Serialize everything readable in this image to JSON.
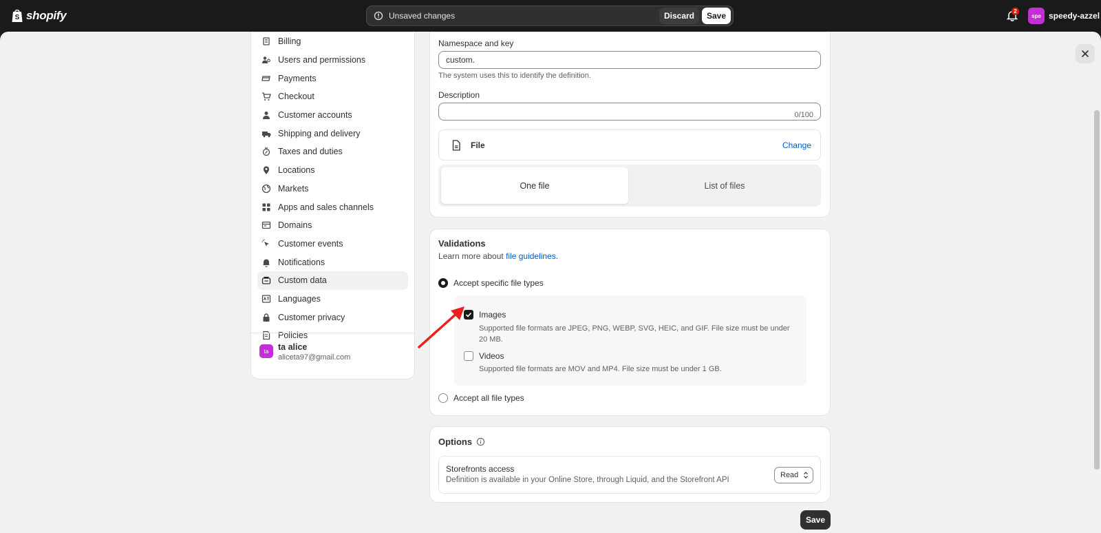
{
  "topbar": {
    "logo_text": "shopify",
    "unsaved_message": "Unsaved changes",
    "discard_label": "Discard",
    "save_label": "Save",
    "notification_count": "2",
    "store_avatar": "spe",
    "store_name": "speedy-azzel"
  },
  "sidebar": {
    "items": [
      {
        "label": "Billing",
        "icon": "billing-icon"
      },
      {
        "label": "Users and permissions",
        "icon": "users-icon"
      },
      {
        "label": "Payments",
        "icon": "payments-icon"
      },
      {
        "label": "Checkout",
        "icon": "cart-icon"
      },
      {
        "label": "Customer accounts",
        "icon": "person-icon"
      },
      {
        "label": "Shipping and delivery",
        "icon": "truck-icon"
      },
      {
        "label": "Taxes and duties",
        "icon": "taxes-icon"
      },
      {
        "label": "Locations",
        "icon": "location-icon"
      },
      {
        "label": "Markets",
        "icon": "globe-icon"
      },
      {
        "label": "Apps and sales channels",
        "icon": "apps-icon"
      },
      {
        "label": "Domains",
        "icon": "domains-icon"
      },
      {
        "label": "Customer events",
        "icon": "cursor-icon"
      },
      {
        "label": "Notifications",
        "icon": "bell-icon"
      },
      {
        "label": "Custom data",
        "icon": "custom-data-icon"
      },
      {
        "label": "Languages",
        "icon": "languages-icon"
      },
      {
        "label": "Customer privacy",
        "icon": "lock-icon"
      },
      {
        "label": "Policies",
        "icon": "policies-icon"
      }
    ],
    "active_item": "Custom data",
    "user": {
      "avatar": "ta",
      "name": "ta alice",
      "email": "aliceta97@gmail.com"
    }
  },
  "definition": {
    "namespace_label": "Namespace and key",
    "namespace_value": "custom.",
    "namespace_help": "The system uses this to identify the definition.",
    "description_label": "Description",
    "description_value": "",
    "description_counter": "0/100",
    "type_name": "File",
    "change_label": "Change",
    "segment_options": [
      "One file",
      "List of files"
    ],
    "segment_selected": "One file"
  },
  "validations": {
    "title": "Validations",
    "learn_prefix": "Learn more about ",
    "learn_link": "file guidelines",
    "learn_suffix": ".",
    "radio_specific": "Accept specific file types",
    "radio_all": "Accept all file types",
    "radio_selected": "specific",
    "images_label": "Images",
    "images_checked": true,
    "images_help": "Supported file formats are JPEG, PNG, WEBP, SVG, HEIC, and GIF. File size must be under 20 MB.",
    "videos_label": "Videos",
    "videos_checked": false,
    "videos_help": "Supported file formats are MOV and MP4. File size must be under 1 GB."
  },
  "options": {
    "title": "Options",
    "storefront_title": "Storefronts access",
    "storefront_desc": "Definition is available in your Online Store, through Liquid, and the Storefront API",
    "storefront_value": "Read"
  },
  "footer": {
    "save_label": "Save"
  },
  "colors": {
    "accent_link": "#005bd3",
    "avatar": "#c22fd6",
    "annotation_arrow": "#e8211a"
  }
}
